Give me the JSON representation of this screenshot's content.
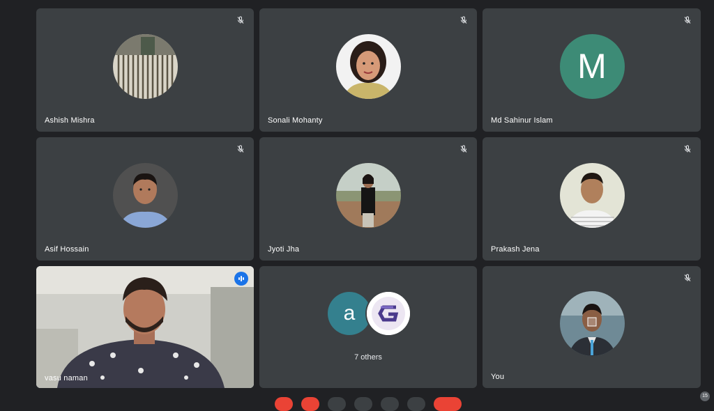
{
  "participants": [
    {
      "name": "Ashish Mishra"
    },
    {
      "name": "Sonali Mohanty"
    },
    {
      "name": "Md Sahinur Islam",
      "initial": "M"
    },
    {
      "name": "Asif Hossain"
    },
    {
      "name": "Jyoti Jha"
    },
    {
      "name": "Prakash Jena"
    },
    {
      "name": "vasu naman"
    },
    {
      "others_label": "7 others",
      "initial": "a"
    },
    {
      "name": "You"
    }
  ],
  "participant_count": "15",
  "colors": {
    "background": "#202124",
    "tile": "#3c4043",
    "speaking_border": "#8ab4f8",
    "speaking_badge": "#1a73e8",
    "avatar_m": "#3d8b76",
    "avatar_a": "#34808e",
    "end_call": "#ea4335"
  }
}
